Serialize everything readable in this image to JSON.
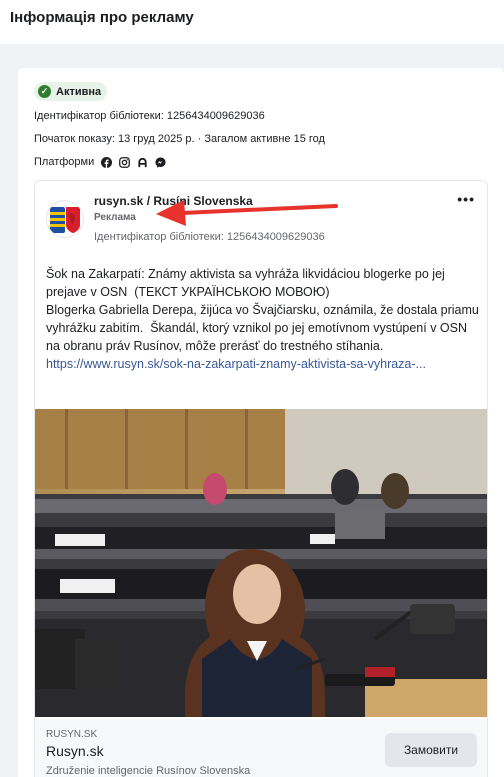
{
  "header": {
    "title": "Інформація про рекламу"
  },
  "status": {
    "label": "Активна",
    "color": "#2e7d32"
  },
  "library_id_line": "Ідентифікатор бібліотеки: 1256434009629036",
  "start_line": "Початок показу: 13 груд 2025 р. · Загалом активне 15 год",
  "platforms": {
    "label": "Платформи",
    "icons": [
      "facebook-icon",
      "instagram-icon",
      "audience-network-icon",
      "messenger-icon"
    ]
  },
  "ad": {
    "page_name": "rusyn.sk / Rusíni Slovenska",
    "sponsored": "Реклама",
    "library_id": "Ідентифікатор бібліотеки: 1256434009629036",
    "text": "Šok na Zakarpatí: Známy aktivista sa vyhráža likvidáciou blogerke po jej prejave v OSN  (ТЕКСТ УКРАЇНСЬКОЮ МОВОЮ)\nBlogerka Gabriella Derepa, žijúca vo Švajčiarsku, oznámila, že dostala priamu vyhrážku zabitím.  Škandál, ktorý vznikol po jej emotívnom vystúpení v OSN na obranu práv Rusínov, môže prerásť do trestného stíhania.",
    "link": "https://www.rusyn.sk/sok-na-zakarpati-znamy-aktivista-sa-vyhraza-...",
    "footer": {
      "domain": "RUSYN.SK",
      "title": "Rusyn.sk",
      "description": "Združenie inteligencie Rusínov Slovenska",
      "cta": "Замовити"
    },
    "more_icon": "more-horizontal-icon"
  },
  "accent_colors": {
    "arrow": "#e8322c",
    "link": "#385898"
  }
}
